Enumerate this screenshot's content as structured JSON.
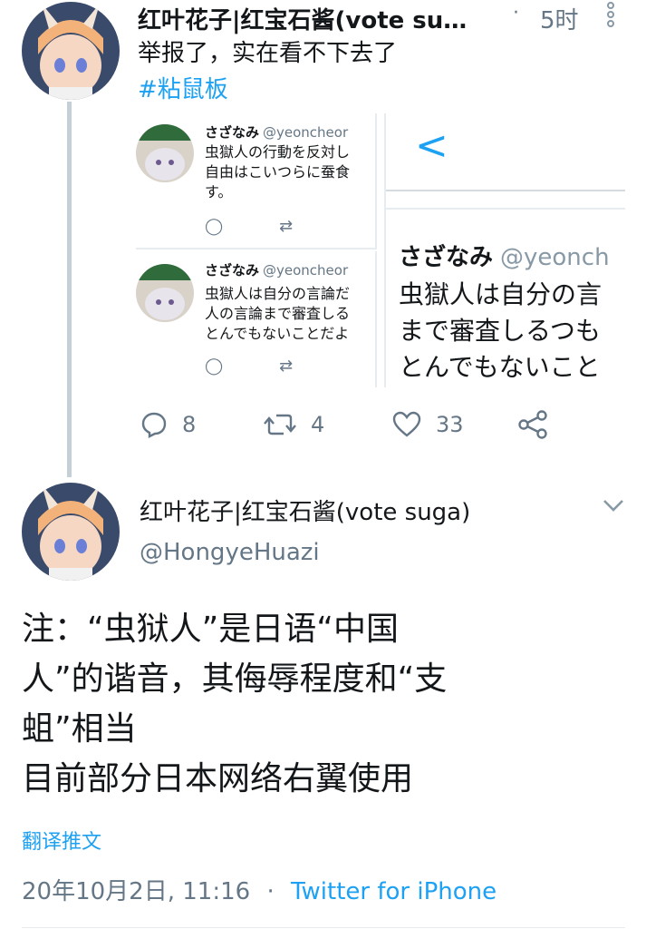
{
  "tweet": {
    "display_name": "红叶花子|红宝石酱(vote su…",
    "separator": "·",
    "time": "5时",
    "text": "举报了，实在看不下去了",
    "hashtag": "#粘鼠板",
    "actions": {
      "replies": "8",
      "retweets": "4",
      "likes": "33"
    },
    "quoted": {
      "top_left": {
        "name": "さざなみ",
        "handle": "@yeoncheor",
        "text": "虫獄人の行動を反対し\n自由はこいつらに蚕食\nす。"
      },
      "bottom_left": {
        "name": "さざなみ",
        "handle": "@yeoncheor",
        "text": "虫獄人は自分の言論だ\n人の言論まで審査しる\nとんでもないことだよ"
      },
      "right": {
        "back_glyph": "<",
        "name": "さざなみ",
        "handle": "@yeonch",
        "text": "虫獄人は自分の言\nまで審査しるつも\nとんでもないこと"
      }
    }
  },
  "main_tweet": {
    "display_name": "红叶花子|红宝石酱(vote suga)",
    "handle": "@HongyeHuazi",
    "body": "注：“虫狱人”是日语“中国\n人”的谐音，其侮辱程度和“支\n蛆”相当\n目前部分日本网络右翼使用",
    "translate": "翻译推文",
    "timestamp": "20年10月2日, 11:16",
    "dot": "·",
    "source": "Twitter for iPhone"
  },
  "colors": {
    "link": "#1da1f2",
    "muted": "#657786",
    "thread": "#c4cfd6"
  },
  "icons": [
    "more-vertical-icon",
    "reply-icon",
    "retweet-icon",
    "like-icon",
    "share-icon",
    "chevron-down-icon",
    "back-chevron-icon"
  ]
}
